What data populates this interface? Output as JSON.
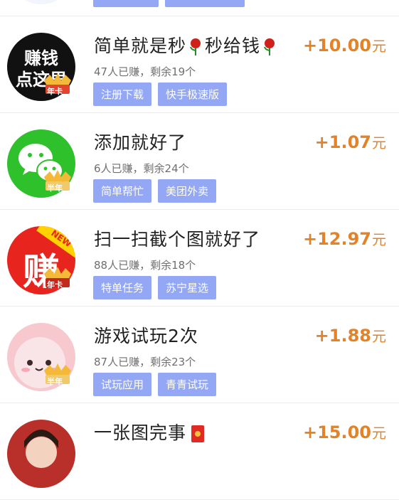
{
  "tasks": [
    {
      "title": "",
      "meta": "",
      "tags": [
        "",
        ""
      ],
      "reward_amount": "",
      "reward_unit": ""
    },
    {
      "title_part1": "简单就是秒",
      "title_part2": "秒给钱",
      "avatar_text_line1": "赚钱",
      "avatar_text_line2": "点这里",
      "badge": "年卡",
      "meta": "47人已赚，剩余19个",
      "tags": [
        "注册下载",
        "快手极速版"
      ],
      "reward_amount": "+10.00",
      "reward_unit": "元"
    },
    {
      "title": "添加就好了",
      "badge": "半年",
      "meta": "6人已赚，剩余24个",
      "tags": [
        "简单帮忙",
        "美团外卖"
      ],
      "reward_amount": "+1.07",
      "reward_unit": "元"
    },
    {
      "title": "扫一扫截个图就好了",
      "avatar_new": "NEW",
      "avatar_char": "赚",
      "badge": "年卡",
      "meta": "88人已赚，剩余18个",
      "tags": [
        "特单任务",
        "苏宁星选"
      ],
      "reward_amount": "+12.97",
      "reward_unit": "元"
    },
    {
      "title": "游戏试玩2次",
      "badge": "半年",
      "meta": "87人已赚，剩余23个",
      "tags": [
        "试玩应用",
        "青青试玩"
      ],
      "reward_amount": "+1.88",
      "reward_unit": "元"
    },
    {
      "title": "一张图完事",
      "meta": "",
      "tags": [],
      "reward_amount": "+15.00",
      "reward_unit": "元"
    }
  ],
  "colors": {
    "tag_bg": "#93a7f5",
    "reward": "#e38227",
    "wechat_green": "#2fc12b"
  },
  "icons": [
    "rose-icon",
    "red-envelope-icon",
    "crown-icon",
    "wechat-icon"
  ]
}
